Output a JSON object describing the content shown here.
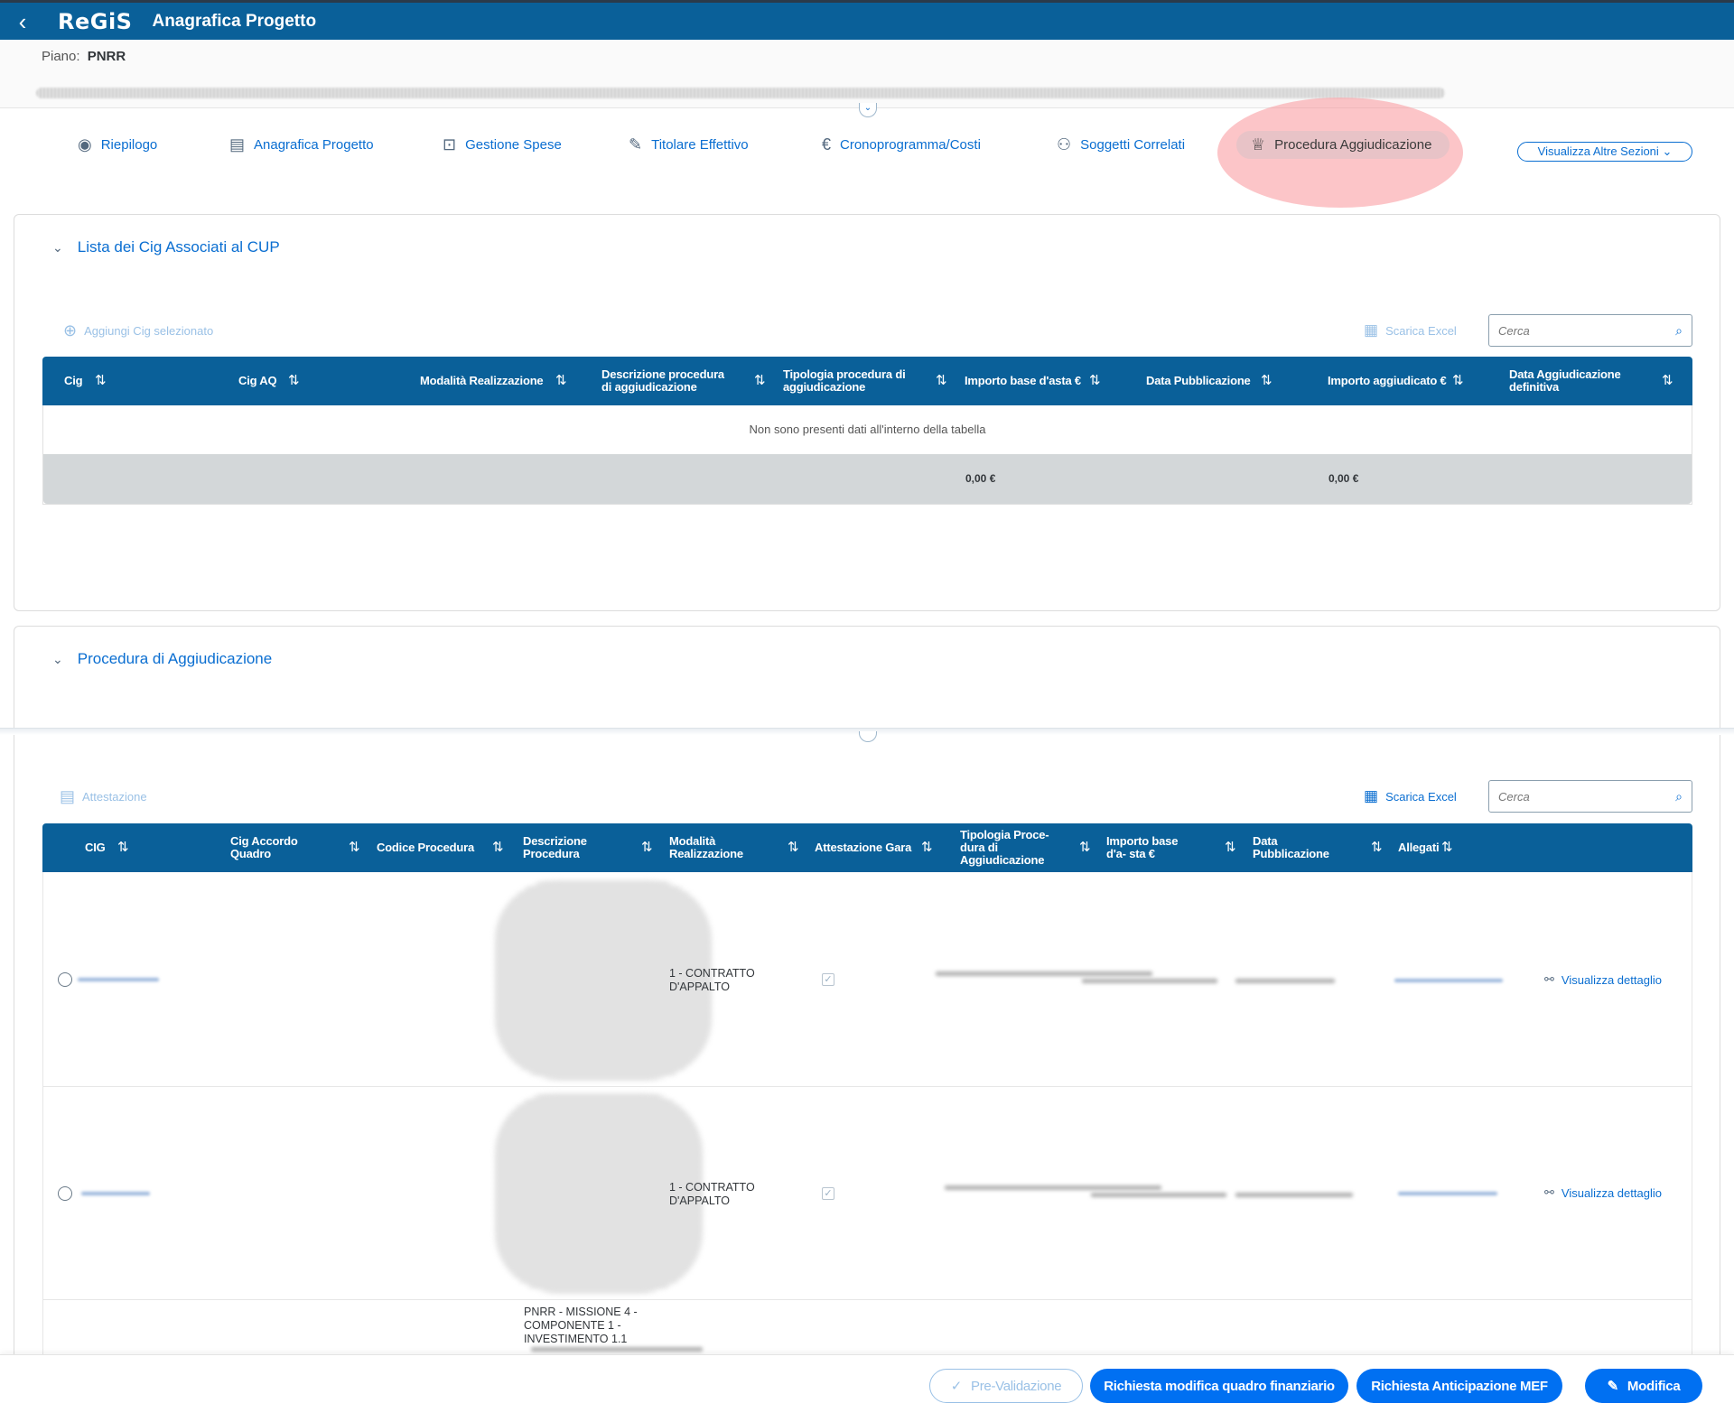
{
  "app": {
    "logo": "ReGiS",
    "title": "Anagrafica Progetto",
    "back_icon": "chevron-left-icon"
  },
  "header": {
    "piano_label": "Piano:",
    "piano_value": "PNRR"
  },
  "tabs": [
    {
      "label": "Riepilogo",
      "icon": "eye-icon"
    },
    {
      "label": "Anagrafica Progetto",
      "icon": "document-icon"
    },
    {
      "label": "Gestione Spese",
      "icon": "code-icon"
    },
    {
      "label": "Titolare Effettivo",
      "icon": "edit-icon"
    },
    {
      "label": "Cronoprogramma/Costi",
      "icon": "euro-icon"
    },
    {
      "label": "Soggetti Correlati",
      "icon": "person-icon"
    },
    {
      "label": "Procedura Aggiudicazione",
      "icon": "trophy-icon",
      "active": true
    }
  ],
  "more_sections": "Visualizza Altre Sezioni",
  "cig_panel": {
    "title": "Lista dei Cig Associati al CUP",
    "add_action": "Aggiungi Cig selezionato",
    "excel": "Scarica Excel",
    "search_placeholder": "Cerca",
    "columns": [
      "Cig",
      "Cig AQ",
      "Modalità Realizzazione",
      "Descrizione procedura di aggiudicazione",
      "Tipologia procedura di aggiudicazione",
      "Importo base d'asta €",
      "Data Pubblicazione",
      "Importo aggiudicato €",
      "Data Aggiudicazione definitiva"
    ],
    "empty_text": "Non sono presenti dati all'interno della tabella",
    "totals": {
      "importo_base": "0,00 €",
      "importo_aggiudicato": "0,00 €"
    }
  },
  "procedura_panel": {
    "title": "Procedura di Aggiudicazione",
    "action": "Attestazione",
    "excel": "Scarica Excel",
    "search_placeholder": "Cerca",
    "columns": [
      "CIG",
      "Cig Accordo Quadro",
      "Codice Procedura",
      "Descrizione Procedura",
      "Modalità Realizzazione",
      "Attestazione Gara",
      "Tipologia Proce- dura di Aggiudicazione",
      "Importo base d'a- sta €",
      "Data Pubblicazione",
      "Allegati"
    ],
    "rows": [
      {
        "modalita": "1 - CONTRATTO D'APPALTO",
        "attestazione_checked": true,
        "detail": "Visualizza dettaglio"
      },
      {
        "modalita": "1 - CONTRATTO D'APPALTO",
        "attestazione_checked": true,
        "detail": "Visualizza dettaglio"
      },
      {
        "descrizione": "PNRR - MISSIONE 4 - COMPONENTE 1 - INVESTIMENTO 1.1"
      }
    ]
  },
  "footer": {
    "prevalidazione": "Pre-Validazione",
    "richiesta_modifica": "Richiesta modifica quadro finanziario",
    "richiesta_anticipazione": "Richiesta Anticipazione MEF",
    "modifica": "Modifica"
  },
  "colors": {
    "shell": "#0a6099",
    "link": "#0a6ed1",
    "primary_button": "#0070f2",
    "highlight": "#fa969b"
  }
}
